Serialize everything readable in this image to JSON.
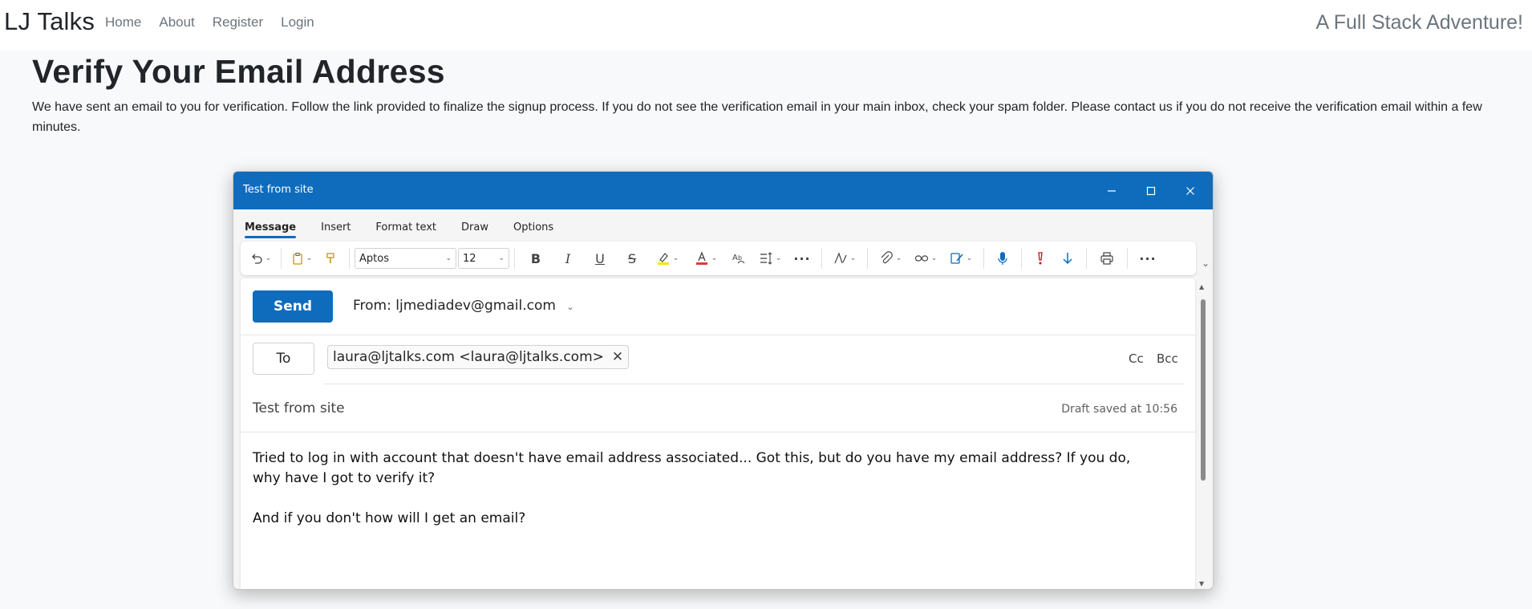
{
  "site": {
    "brand": "LJ Talks",
    "nav": [
      "Home",
      "About",
      "Register",
      "Login"
    ],
    "tagline": "A Full Stack Adventure!"
  },
  "page": {
    "title": "Verify Your Email Address",
    "text": "We have sent an email to you for verification. Follow the link provided to finalize the signup process. If you do not see the verification email in your main inbox, check your spam folder. Please contact us if you do not receive the verification email within a few minutes."
  },
  "compose_window": {
    "title": "Test from site",
    "tabs": [
      "Message",
      "Insert",
      "Format text",
      "Draw",
      "Options"
    ],
    "active_tab": "Message",
    "ribbon": {
      "font_name": "Aptos",
      "font_size": "12",
      "icons": [
        "undo-icon",
        "paste-icon",
        "format-painter-icon",
        "bold-icon",
        "italic-icon",
        "underline-icon",
        "strikethrough-icon",
        "highlight-icon",
        "font-color-icon",
        "styles-icon",
        "spacing-icon",
        "more-icon",
        "editor-icon",
        "attach-icon",
        "link-icon",
        "signature-icon",
        "dictate-icon",
        "high-importance-icon",
        "low-importance-icon",
        "print-icon",
        "more-options-icon"
      ],
      "highlight_color": "#f6e600",
      "font_color": "#e03b3b"
    },
    "send_label": "Send",
    "from_label": "From:",
    "from_value": "ljmediadev@gmail.com",
    "to_label": "To",
    "recipient": "laura@ljtalks.com <laura@ljtalks.com>",
    "cc_label": "Cc",
    "bcc_label": "Bcc",
    "subject": "Test from site",
    "draft_status": "Draft saved at 10:56",
    "body": "Tried to log in with account that doesn't have email address associated... Got this, but do you have my email address? If you do,\nwhy have I got to verify it?\n\nAnd if you don't how will I get an email?",
    "accent_color": "#0f6cbd"
  }
}
